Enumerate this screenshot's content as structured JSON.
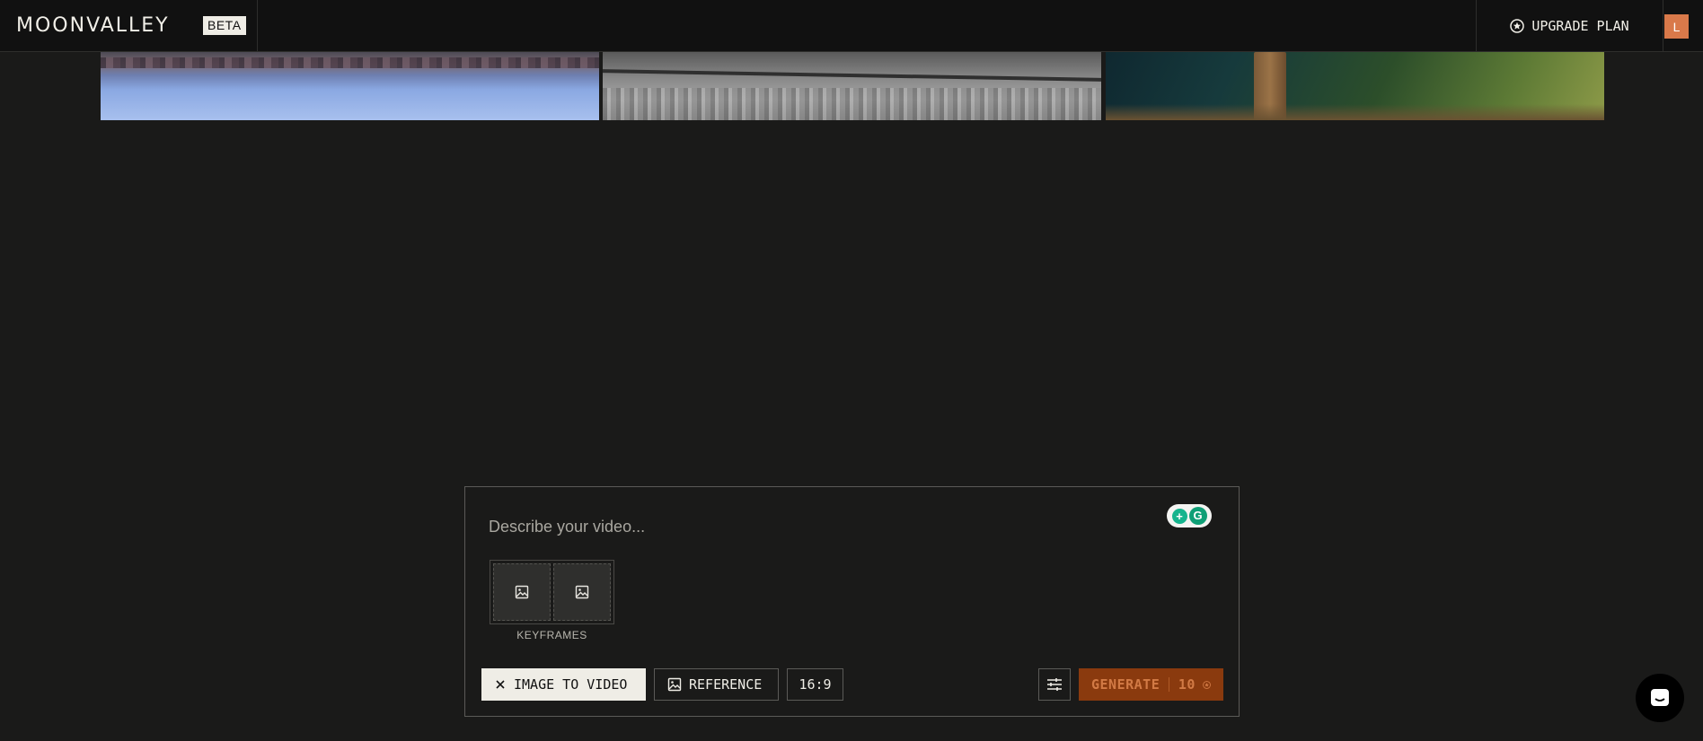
{
  "header": {
    "logo": "MOONVALLEY",
    "beta_badge": "BETA",
    "upgrade_label": "UPGRADE PLAN",
    "avatar_initial": "L"
  },
  "gallery": {
    "thumbnails": [
      "snowy-lake-thumbnail",
      "rocky-surface-thumbnail",
      "mountain-hiker-thumbnail"
    ]
  },
  "composer": {
    "prompt_placeholder": "Describe your video...",
    "prompt_value": "",
    "keyframes_label": "KEYFRAMES",
    "mode_label": "IMAGE TO VIDEO",
    "reference_label": "REFERENCE",
    "aspect_ratio": "16:9",
    "generate_label": "GENERATE",
    "generate_cost": "10"
  },
  "colors": {
    "background": "#1a1a19",
    "topbar": "#111111",
    "avatar": "#d9794a",
    "generate_bg": "#8a3a0e",
    "generate_text": "#d27a45"
  }
}
